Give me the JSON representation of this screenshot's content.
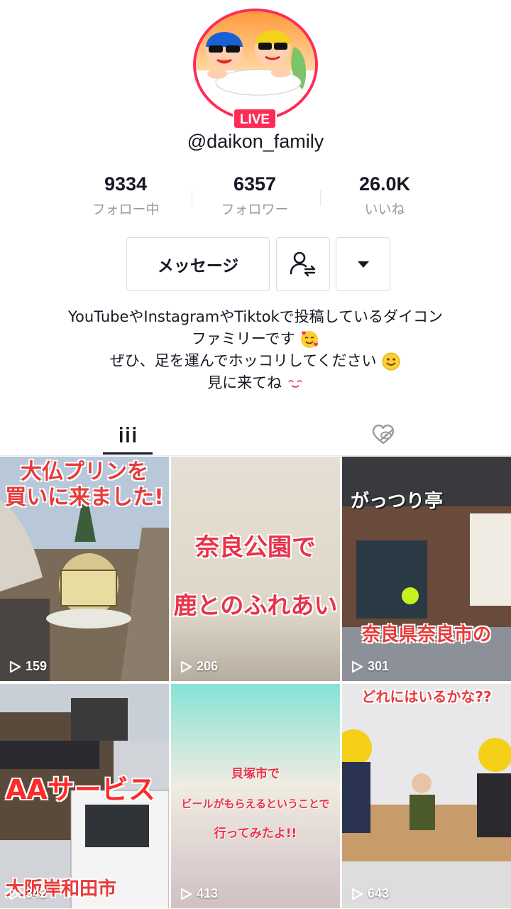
{
  "profile": {
    "username": "@daikon_family",
    "live_badge": "LIVE"
  },
  "stats": [
    {
      "value": "9334",
      "label": "フォロー中"
    },
    {
      "value": "6357",
      "label": "フォロワー"
    },
    {
      "value": "26.0K",
      "label": "いいね"
    }
  ],
  "actions": {
    "message_label": "メッセージ"
  },
  "bio": {
    "line1": "YouTubeやInstagramやTiktokで投稿しているダイコン",
    "line2": "ファミリーです",
    "line3": "ぜひ、足を運んでホッコリしてください",
    "line4": "見に来てね"
  },
  "videos": [
    {
      "caption_line1": "大仏プリンを",
      "caption_line2": "買いに来ました!",
      "views": "159"
    },
    {
      "caption_line1": "奈良公園で",
      "caption_line2": "鹿とのふれあい",
      "views": "206"
    },
    {
      "caption_line1": "がっつり亭",
      "caption_line2": "奈良県奈良市の",
      "views": "301"
    },
    {
      "caption_line1": "AAサービス",
      "caption_line2": "大阪岸和田市",
      "views": "342"
    },
    {
      "caption_line1": "貝塚市で",
      "caption_line2": "ビールがもらえるということで",
      "caption_line3": "行ってみたよ!!",
      "views": "413"
    },
    {
      "caption_line1": "どれにはいるかな??",
      "views": "643"
    }
  ],
  "colors": {
    "accent": "#fe2c55",
    "text": "#161823",
    "muted": "#9a9aa0"
  }
}
